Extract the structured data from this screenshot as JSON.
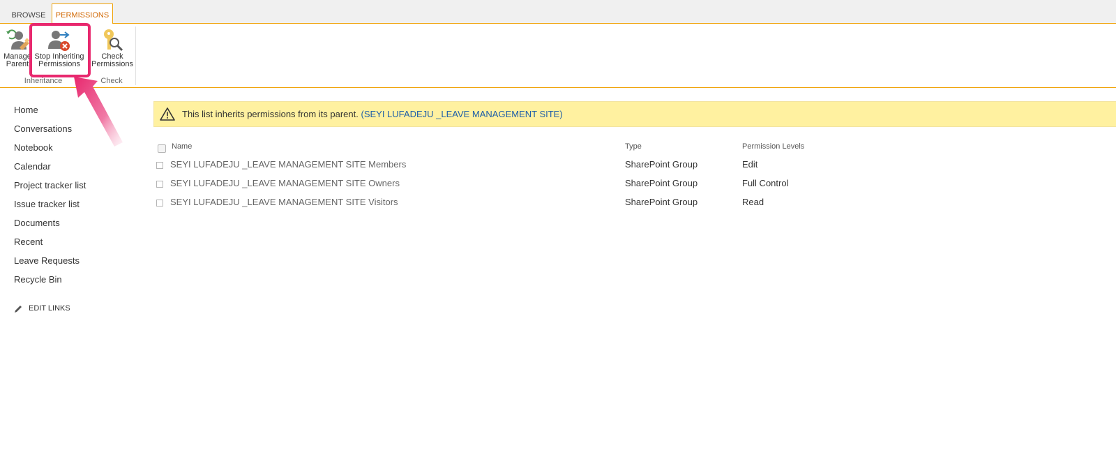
{
  "ribbon": {
    "tabs": [
      {
        "label": "BROWSE",
        "active": false
      },
      {
        "label": "PERMISSIONS",
        "active": true
      }
    ],
    "buttons": {
      "manage_parent": "Manage\nParent",
      "stop_inheriting": "Stop Inheriting\nPermissions",
      "check_permissions": "Check\nPermissions"
    },
    "groups": {
      "inheritance": "Inheritance",
      "check": "Check"
    }
  },
  "nav": {
    "items": [
      "Home",
      "Conversations",
      "Notebook",
      "Calendar",
      "Project tracker list",
      "Issue tracker list",
      "Documents",
      "Recent",
      "Leave Requests",
      "Recycle Bin"
    ],
    "edit_links": "EDIT LINKS"
  },
  "banner": {
    "message": "This list inherits permissions from its parent.",
    "parent_link": "(SEYI LUFADEJU _LEAVE MANAGEMENT SITE)"
  },
  "table": {
    "headers": {
      "name": "Name",
      "type": "Type",
      "levels": "Permission Levels"
    },
    "rows": [
      {
        "name": "SEYI LUFADEJU _LEAVE MANAGEMENT SITE Members",
        "type": "SharePoint Group",
        "level": "Edit"
      },
      {
        "name": "SEYI LUFADEJU _LEAVE MANAGEMENT SITE Owners",
        "type": "SharePoint Group",
        "level": "Full Control"
      },
      {
        "name": "SEYI LUFADEJU _LEAVE MANAGEMENT SITE Visitors",
        "type": "SharePoint Group",
        "level": "Read"
      }
    ]
  },
  "colors": {
    "accent": "#f0a30a",
    "highlight": "#e8286e",
    "banner": "#fff1a0",
    "link": "#1f5fa8"
  }
}
